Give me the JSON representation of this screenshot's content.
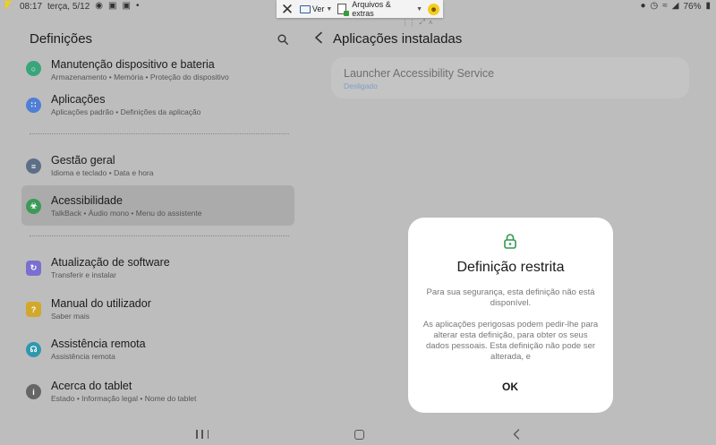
{
  "statusbar": {
    "time": "08:17",
    "date": "terça, 5/12",
    "battery": "76%"
  },
  "remote_toolbar": {
    "view_label": "Ver",
    "files_label": "Arquivos & extras"
  },
  "settings": {
    "title": "Definições",
    "items": [
      {
        "title": "Manutenção dispositivo e bateria",
        "subtitle": "Armazenamento  •  Memória  •  Proteção do dispositivo",
        "icon": "device-care-icon",
        "color": "#3aa57a"
      },
      {
        "title": "Aplicações",
        "subtitle": "Aplicações padrão  •  Definições da aplicação",
        "icon": "apps-icon",
        "color": "#4f7fd6"
      },
      {
        "title": "Gestão geral",
        "subtitle": "Idioma e teclado  •  Data e hora",
        "icon": "sliders-icon",
        "color": "#5d6f86"
      },
      {
        "title": "Acessibilidade",
        "subtitle": "TalkBack  •  Áudio mono  •  Menu do assistente",
        "icon": "accessibility-icon",
        "color": "#3b9a57"
      },
      {
        "title": "Atualização de software",
        "subtitle": "Transferir e instalar",
        "icon": "software-update-icon",
        "color": "#7a6fd0"
      },
      {
        "title": "Manual do utilizador",
        "subtitle": "Saber mais",
        "icon": "manual-icon",
        "color": "#d2a82a"
      },
      {
        "title": "Assistência remota",
        "subtitle": "Assistência remota",
        "icon": "headset-icon",
        "color": "#2f98ad"
      },
      {
        "title": "Acerca do tablet",
        "subtitle": "Estado  •  Informação legal  •  Nome do tablet",
        "icon": "info-icon",
        "color": "#666666"
      }
    ]
  },
  "installed_apps": {
    "title": "Aplicações instaladas",
    "app_name": "Launcher Accessibility Service",
    "app_status": "Desligado"
  },
  "dialog": {
    "title": "Definição restrita",
    "paragraph1": "Para sua segurança, esta definição não está disponível.",
    "paragraph2": "As aplicações perigosas podem pedir-lhe para alterar esta definição, para obter os seus dados pessoais. Esta definição não pode ser alterada, e",
    "ok_label": "OK"
  }
}
